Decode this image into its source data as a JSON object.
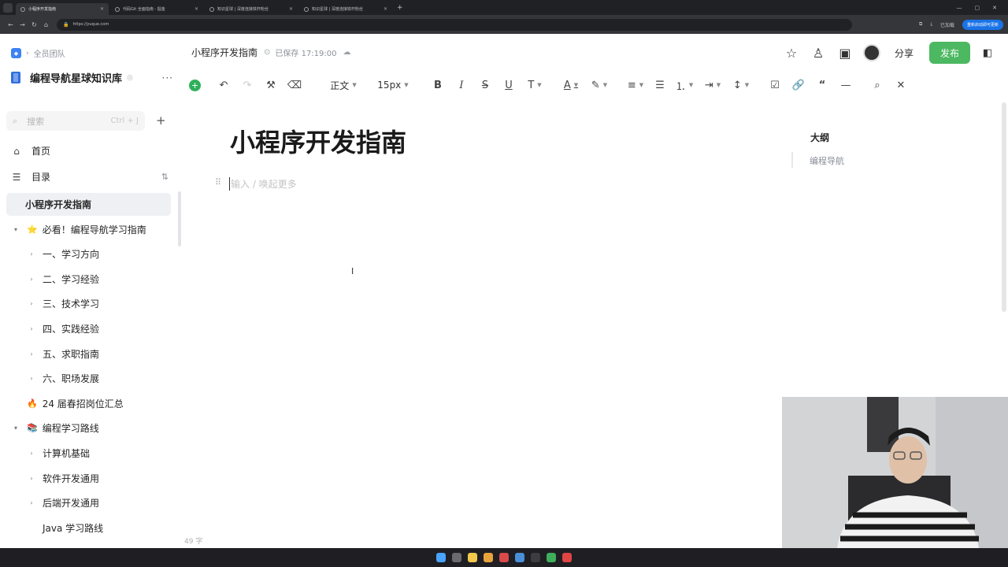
{
  "browser": {
    "tabs": [
      {
        "title": "小程序开发指南",
        "active": true
      },
      {
        "title": "代码Git 全面指南 - 掘金",
        "active": false
      },
      {
        "title": "知识星球 | 深度连接铁杆粉丝",
        "active": false
      },
      {
        "title": "知识星球 | 深度连接铁杆粉丝",
        "active": false
      }
    ],
    "new_tab": "+",
    "url": "https://yuque.com",
    "right_label": "已加载",
    "update_pill": "重新启动即可更新"
  },
  "sidebar": {
    "team": "全员团队",
    "kb_name": "编程导航星球知识库",
    "search_placeholder": "搜索",
    "search_shortcut": "Ctrl + J",
    "nav": [
      {
        "label": "首页",
        "icon": "home-icon"
      },
      {
        "label": "目录",
        "icon": "catalog-icon"
      }
    ],
    "tree": [
      {
        "label": "小程序开发指南",
        "indent": 1,
        "arrow": "",
        "emoji": "",
        "selected": true
      },
      {
        "label": "必看！编程导航学习指南",
        "indent": 0,
        "arrow": "▾",
        "emoji": "⭐",
        "selected": false
      },
      {
        "label": "一、学习方向",
        "indent": 1,
        "arrow": "›",
        "emoji": "",
        "selected": false
      },
      {
        "label": "二、学习经验",
        "indent": 1,
        "arrow": "›",
        "emoji": "",
        "selected": false
      },
      {
        "label": "三、技术学习",
        "indent": 1,
        "arrow": "›",
        "emoji": "",
        "selected": false
      },
      {
        "label": "四、实践经验",
        "indent": 1,
        "arrow": "›",
        "emoji": "",
        "selected": false
      },
      {
        "label": "五、求职指南",
        "indent": 1,
        "arrow": "›",
        "emoji": "",
        "selected": false
      },
      {
        "label": "六、职场发展",
        "indent": 1,
        "arrow": "›",
        "emoji": "",
        "selected": false
      },
      {
        "label": "24 届春招岗位汇总",
        "indent": 0,
        "arrow": "",
        "emoji": "🔥",
        "selected": false
      },
      {
        "label": "编程学习路线",
        "indent": 0,
        "arrow": "▾",
        "emoji": "📚",
        "selected": false
      },
      {
        "label": "计算机基础",
        "indent": 1,
        "arrow": "›",
        "emoji": "",
        "selected": false
      },
      {
        "label": "软件开发通用",
        "indent": 1,
        "arrow": "›",
        "emoji": "",
        "selected": false
      },
      {
        "label": "后端开发通用",
        "indent": 1,
        "arrow": "›",
        "emoji": "",
        "selected": false
      },
      {
        "label": "Java 学习路线",
        "indent": 1,
        "arrow": "",
        "emoji": "",
        "selected": false
      }
    ]
  },
  "header": {
    "doc_title": "小程序开发指南",
    "saved_status": "已保存 17:19:00",
    "share_label": "分享",
    "publish_label": "发布"
  },
  "toolbar": {
    "style_label": "正文",
    "size_label": "15px"
  },
  "editor": {
    "title": "小程序开发指南",
    "placeholder": "输入 / 唤起更多",
    "word_count": "49 字"
  },
  "outline": {
    "heading": "大纲",
    "items": [
      "编程导航"
    ]
  },
  "colors": {
    "publish": "#4cb861",
    "insert": "#2fb05a",
    "kb_icon": "#2f6fde"
  }
}
